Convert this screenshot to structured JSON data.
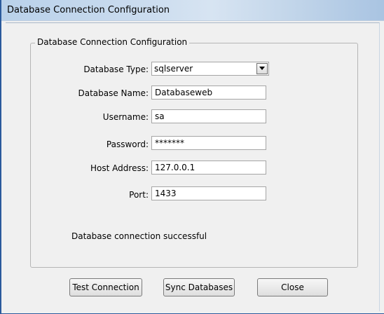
{
  "window": {
    "title": "Database Connection Configuration"
  },
  "group": {
    "legend": "Database Connection Configuration"
  },
  "fields": {
    "db_type": {
      "label": "Database Type:",
      "value": "sqlserver"
    },
    "db_name": {
      "label": "Database Name:",
      "value": "Databaseweb"
    },
    "username": {
      "label": "Username:",
      "value": "sa"
    },
    "password": {
      "label": "Password:",
      "value": "*******"
    },
    "host": {
      "label": "Host Address:",
      "value": "127.0.0.1"
    },
    "port": {
      "label": "Port:",
      "value": "1433"
    }
  },
  "status": {
    "message": "Database connection successful"
  },
  "buttons": {
    "test": "Test Connection",
    "sync": "Sync Databases",
    "close": "Close"
  },
  "icons": {
    "dropdown": "chevron-down-icon"
  }
}
